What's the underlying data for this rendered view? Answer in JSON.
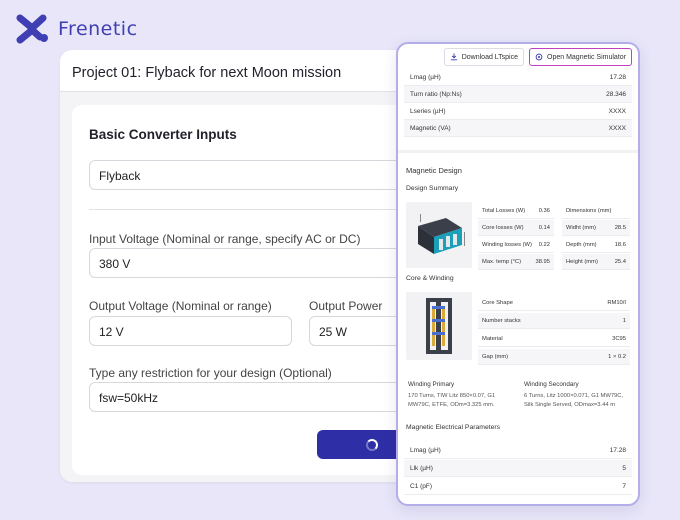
{
  "app": {
    "brand": "Frenetic"
  },
  "project": {
    "title": "Project 01: Flyback for next Moon mission"
  },
  "inputs": {
    "title": "Basic Converter Inputs",
    "topology_value": "Flyback",
    "input_voltage_label": "Input Voltage (Nominal or range, specify AC or DC)",
    "input_voltage_value": "380 V",
    "output_voltage_label": "Output Voltage (Nominal or range)",
    "output_voltage_value": "12 V",
    "output_power_label": "Output Power",
    "output_power_value": "25 W",
    "restriction_label": "Type any restriction for your design (Optional)",
    "restriction_value": "fsw=50kHz"
  },
  "panel": {
    "download_label": "Download LTspice",
    "simulator_label": "Open Magnetic Simulator",
    "top_rows": [
      {
        "label": "Lmag (µH)",
        "value": "17.28"
      },
      {
        "label": "Turn ratio (Np:Ns)",
        "value": "28.346"
      },
      {
        "label": "Lseries (µH)",
        "value": "XXXX"
      },
      {
        "label": "Magnetic (VA)",
        "value": "XXXX"
      }
    ],
    "magnetic_design_title": "Magnetic Design",
    "design_summary_title": "Design Summary",
    "losses": [
      {
        "label": "Total Losses (W)",
        "value": "0.36"
      },
      {
        "label": "Core losses (W)",
        "value": "0.14"
      },
      {
        "label": "Winding losses (W)",
        "value": "0.22"
      },
      {
        "label": "Max. temp (°C)",
        "value": "38.95"
      }
    ],
    "dimensions": [
      {
        "label": "Dimensions (mm)",
        "value": ""
      },
      {
        "label": "Widht (mm)",
        "value": "28.5"
      },
      {
        "label": "Depth (mm)",
        "value": "18.6"
      },
      {
        "label": "Height (mm)",
        "value": "25.4"
      }
    ],
    "core_winding_title": "Core & Winding",
    "core": [
      {
        "label": "Core Shape",
        "value": "RM10/I"
      },
      {
        "label": "Number stacks",
        "value": "1"
      },
      {
        "label": "Material",
        "value": "3C95"
      },
      {
        "label": "Gap (mm)",
        "value": "1 × 0.2"
      }
    ],
    "winding_primary_title": "Winding Primary",
    "winding_primary_text": "170 Turns, TIW Litz 850×0.07, G1 MW79C, ETFE, ODm=3.325 mm.",
    "winding_secondary_title": "Winding Secondary",
    "winding_secondary_text": "6 Turns, Litz 1000×0.071, G1 MW79C, Silk Single Served, ODmax=3.44 m",
    "electrical_title": "Magnetic Electrical Parameters",
    "electrical_rows": [
      {
        "label": "Lmag (µH)",
        "value": "17.28"
      },
      {
        "label": "Llk (µH)",
        "value": "5"
      },
      {
        "label": "C1 (pF)",
        "value": "7"
      }
    ]
  },
  "colors": {
    "brand": "#3f3fb3",
    "primary_button": "#2e2ea6",
    "panel_border": "#b3aee8",
    "simulator_border": "#c040c0"
  }
}
